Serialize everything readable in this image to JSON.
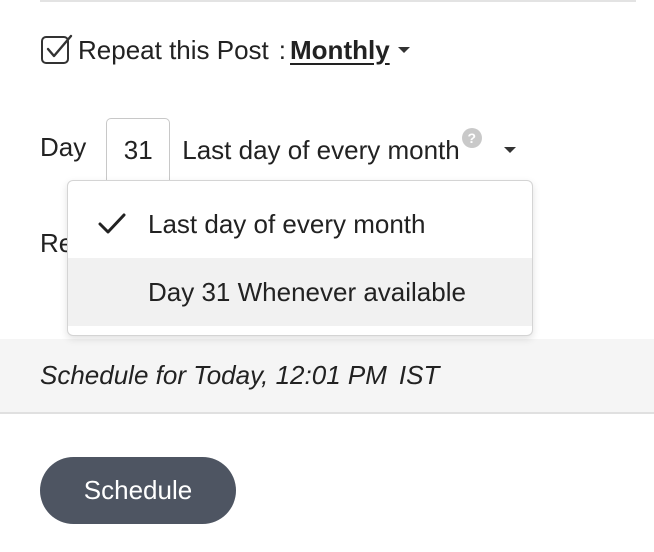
{
  "repeat": {
    "checked": true,
    "label": "Repeat this Post",
    "separator": ":",
    "frequency": "Monthly"
  },
  "day": {
    "label": "Day",
    "value": "31",
    "selected_option": "Last day of every month",
    "help_icon": "?"
  },
  "dropdown": {
    "options": [
      {
        "label": "Last day of every month",
        "selected": true
      },
      {
        "label": "Day 31 Whenever available",
        "selected": false
      }
    ]
  },
  "hidden_row": {
    "partial_label": "Re"
  },
  "schedule": {
    "summary": "Schedule for Today, 12:01 PM",
    "timezone": "IST",
    "button_label": "Schedule"
  },
  "colors": {
    "button_bg": "#4e5562",
    "band_bg": "#f5f5f5",
    "hover_bg": "#f1f1f1"
  },
  "icons": {
    "checkbox": "checkbox-checked-icon",
    "caret": "caret-down-icon",
    "check": "check-icon",
    "help": "help-icon"
  }
}
